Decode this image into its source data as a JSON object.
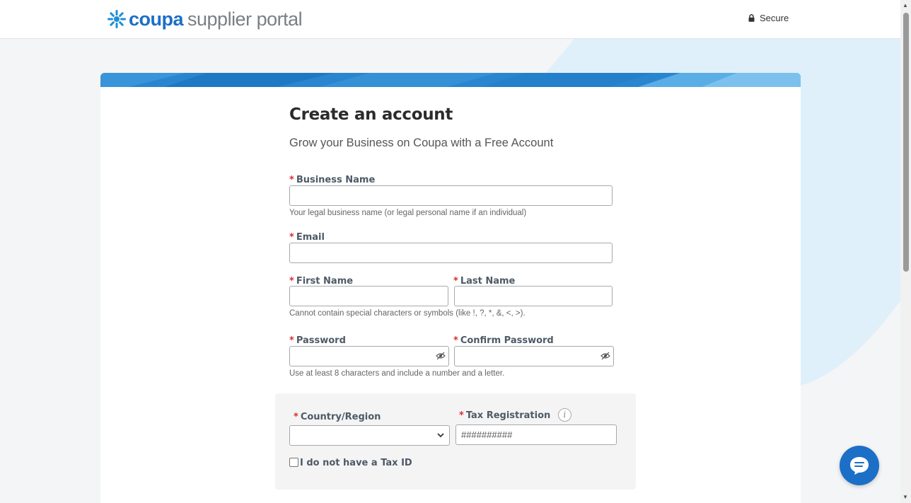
{
  "header": {
    "logo_brand": "coupa",
    "logo_product": "supplier portal",
    "secure_label": "Secure",
    "lock_icon": "lock-icon"
  },
  "form": {
    "title": "Create an account",
    "subtitle": "Grow your Business on Coupa with a Free Account",
    "required_marker": "*",
    "business_name": {
      "label": "Business Name",
      "value": "",
      "hint": "Your legal business name (or legal personal name if an individual)"
    },
    "email": {
      "label": "Email",
      "value": ""
    },
    "first_name": {
      "label": "First Name",
      "value": ""
    },
    "last_name": {
      "label": "Last Name",
      "value": ""
    },
    "name_hint": "Cannot contain special characters or symbols (like !, ?, *, &, <, >).",
    "password": {
      "label": "Password",
      "value": "",
      "icon": "eye-slash-icon"
    },
    "confirm_password": {
      "label": "Confirm Password",
      "value": "",
      "icon": "eye-slash-icon"
    },
    "password_hint": "Use at least 8 characters and include a number and a letter.",
    "country": {
      "label": "Country/Region",
      "selected": ""
    },
    "tax_registration": {
      "label": "Tax Registration",
      "placeholder": "##########",
      "info_icon": "i"
    },
    "no_tax_id": {
      "label": "I do not have a Tax ID",
      "checked": false
    }
  },
  "chat": {
    "icon": "chat-bubble-icon"
  },
  "colors": {
    "brand_blue": "#1c6fc6",
    "required_red": "#d62e2e",
    "background_shape": "#dff0fa"
  }
}
